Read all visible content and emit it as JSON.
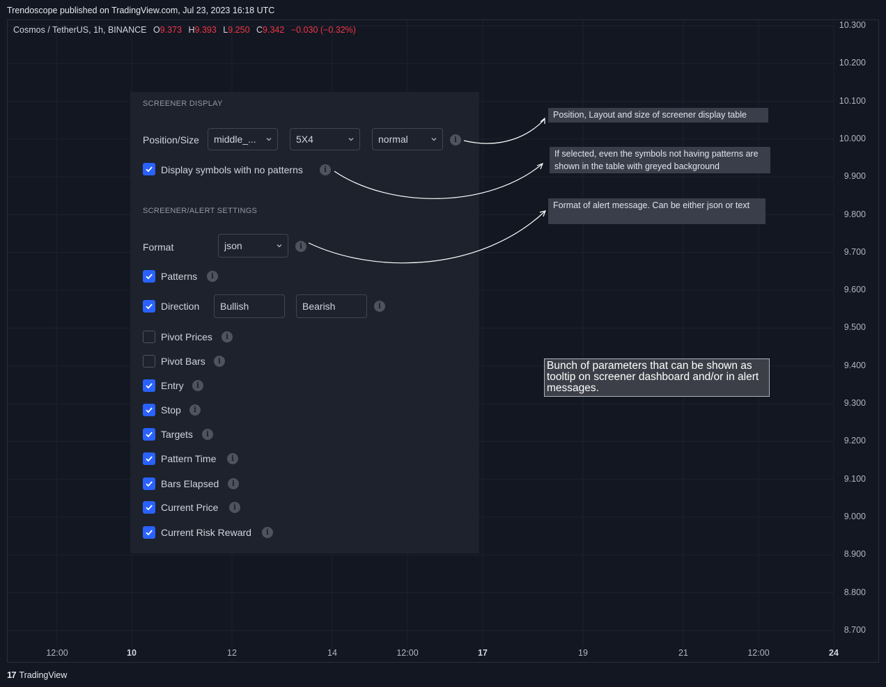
{
  "header": {
    "published": "Trendoscope published on TradingView.com, Jul 23, 2023 16:18 UTC"
  },
  "legend": {
    "symbol": "Cosmos / TetherUS, 1h, BINANCE",
    "o_label": "O",
    "o_value": "9.373",
    "h_label": "H",
    "h_value": "9.393",
    "l_label": "L",
    "l_value": "9.250",
    "c_label": "C",
    "c_value": "9.342",
    "change": "−0.030 (−0.32%)"
  },
  "price_axis": [
    "10.300",
    "10.200",
    "10.100",
    "10.000",
    "9.900",
    "9.800",
    "9.700",
    "9.600",
    "9.500",
    "9.400",
    "9.300",
    "9.200",
    "9.100",
    "9.000",
    "8.900",
    "8.800",
    "8.700"
  ],
  "time_axis": [
    {
      "label": "12:00",
      "bold": false
    },
    {
      "label": "10",
      "bold": true
    },
    {
      "label": "12",
      "bold": false
    },
    {
      "label": "14",
      "bold": false
    },
    {
      "label": "12:00",
      "bold": false
    },
    {
      "label": "17",
      "bold": true
    },
    {
      "label": "19",
      "bold": false
    },
    {
      "label": "21",
      "bold": false
    },
    {
      "label": "12:00",
      "bold": false
    },
    {
      "label": "24",
      "bold": true
    }
  ],
  "panel": {
    "screener_display_title": "SCREENER DISPLAY",
    "position_size_label": "Position/Size",
    "position_value": "middle_...",
    "layout_value": "5X4",
    "size_value": "normal",
    "display_no_patterns_label": "Display symbols with no patterns",
    "display_no_patterns_checked": true,
    "alert_settings_title": "SCREENER/ALERT SETTINGS",
    "format_label": "Format",
    "format_value": "json",
    "direction_bullish": "Bullish",
    "direction_bearish": "Bearish",
    "options": [
      {
        "label": "Patterns",
        "checked": true
      },
      {
        "label": "Direction",
        "checked": true
      },
      {
        "label": "Pivot Prices",
        "checked": false
      },
      {
        "label": "Pivot Bars",
        "checked": false
      },
      {
        "label": "Entry",
        "checked": true
      },
      {
        "label": "Stop",
        "checked": true
      },
      {
        "label": "Targets",
        "checked": true
      },
      {
        "label": "Pattern Time",
        "checked": true
      },
      {
        "label": "Bars Elapsed",
        "checked": true
      },
      {
        "label": "Current Price",
        "checked": true
      },
      {
        "label": "Current Risk Reward",
        "checked": true
      }
    ]
  },
  "notes": {
    "position_note": "Position, Layout and size of screener display table",
    "no_patterns_note": "If selected, even the symbols not having patterns are shown in the table with greyed background",
    "format_note": "Format of alert message. Can be either json or text",
    "params_note": "Bunch of parameters that can be shown as tooltip on screener dashboard and/or in alert messages."
  },
  "footer": {
    "brand": "TradingView",
    "logo": "17"
  },
  "colors": {
    "background": "#131722",
    "panel": "#1e222d",
    "accent": "#2962ff",
    "red": "#f23645"
  }
}
